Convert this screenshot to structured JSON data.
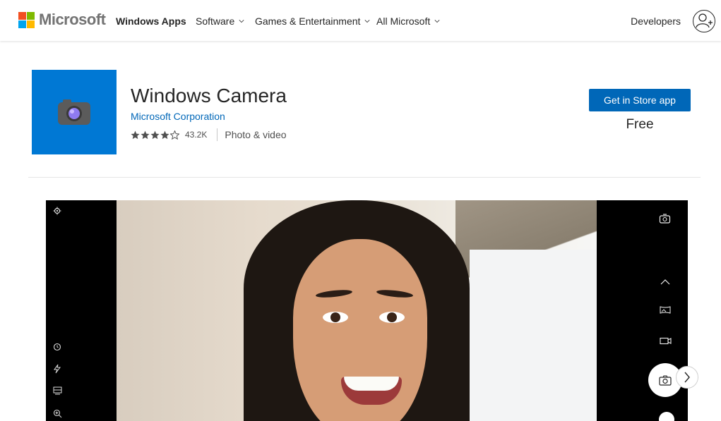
{
  "header": {
    "brand": "Microsoft",
    "nav": [
      {
        "label": "Windows Apps",
        "active": true
      },
      {
        "label": "Software",
        "dropdown": true
      },
      {
        "label": "Games & Entertainment",
        "dropdown": true
      },
      {
        "label": "All Microsoft",
        "dropdown": true
      }
    ],
    "developers": "Developers",
    "icons": [
      "microsoft-logo",
      "chevron-down-icon",
      "user-add-icon"
    ]
  },
  "app": {
    "title": "Windows Camera",
    "publisher": "Microsoft Corporation",
    "rating": 4,
    "max_rating": 5,
    "rating_count": "43.2K",
    "category": "Photo & video",
    "tile_color": "#0078d4",
    "cta": "Get in Store app",
    "price": "Free"
  },
  "screenshot": {
    "icons": [
      "settings-icon",
      "timer-icon",
      "flash-icon",
      "framing-grid-icon",
      "zoom-icon",
      "switch-camera-icon",
      "chevron-up-icon",
      "panorama-icon",
      "video-icon",
      "camera-icon",
      "document-icon",
      "chevron-right-icon"
    ]
  },
  "colors": {
    "accent": "#0067b8",
    "link": "#0067b8"
  }
}
